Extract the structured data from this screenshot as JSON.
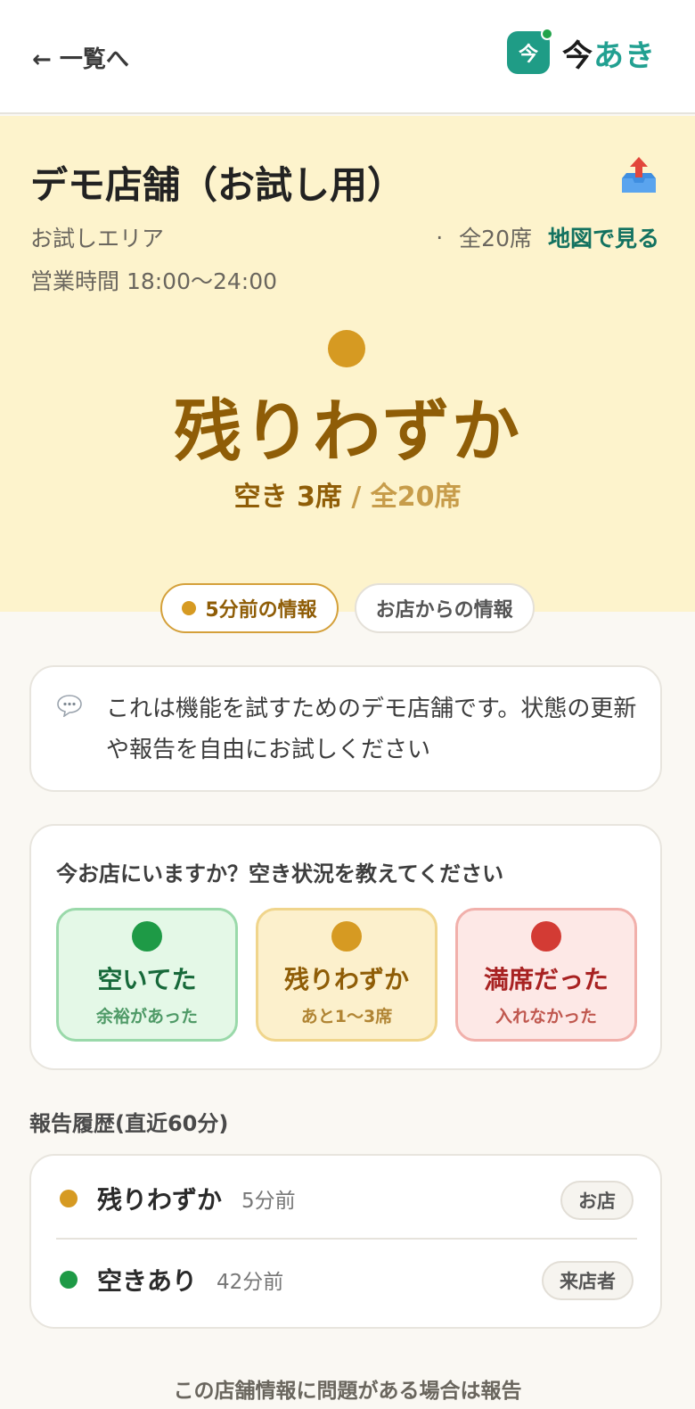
{
  "header": {
    "back_label": "← 一覧へ",
    "logo_glyph": "今",
    "brand_part1": "今",
    "brand_part2": "あき"
  },
  "shop": {
    "name": "デモ店舗（お試し用）",
    "area": "お試しエリア",
    "separator": "·",
    "total_seats": "全20席",
    "map_link": "地図で見る",
    "hours": "営業時間 18:00〜24:00"
  },
  "status": {
    "label": "残りわずか",
    "available_text": "空き 3席",
    "total_text": "/ 全20席",
    "color": "#d69a22"
  },
  "pills": {
    "recent": "5分前の情報",
    "shop_info": "お店からの情報"
  },
  "notice": {
    "icon": "speech-bubble-icon",
    "text": "これは機能を試すためのデモ店舗です。状態の更新や報告を自由にお試しください"
  },
  "report": {
    "question": "今お店にいますか？空き状況を教えてください",
    "choices": [
      {
        "title": "空いてた",
        "sub": "余裕があった",
        "color": "#1e9a46"
      },
      {
        "title": "残りわずか",
        "sub": "あと1〜3席",
        "color": "#d69a22"
      },
      {
        "title": "満席だった",
        "sub": "入れなかった",
        "color": "#d33b34"
      }
    ]
  },
  "history": {
    "title": "報告履歴(直近60分)",
    "rows": [
      {
        "label": "残りわずか",
        "time": "5分前",
        "source": "お店",
        "color": "#d69a22"
      },
      {
        "label": "空きあり",
        "time": "42分前",
        "source": "来店者",
        "color": "#1e9a46"
      }
    ]
  },
  "footer": {
    "report_issue": "この店舗情報に問題がある場合は報告"
  }
}
